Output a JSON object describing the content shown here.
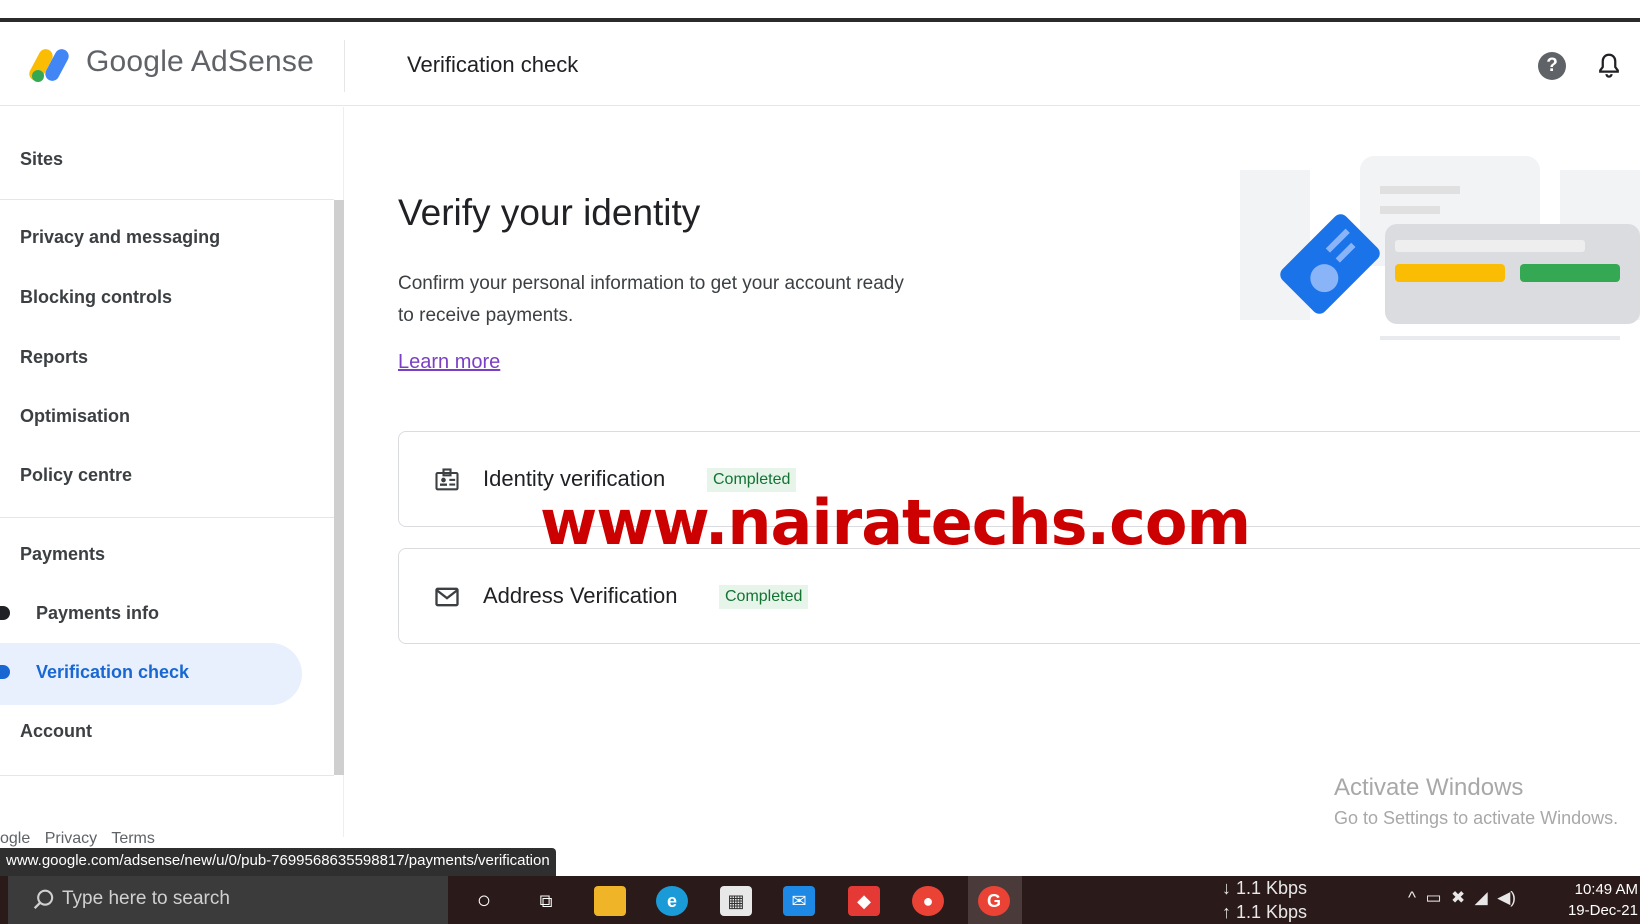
{
  "app": {
    "brand": "Google AdSense",
    "page_heading": "Verification check"
  },
  "sidebar": {
    "items": [
      {
        "label": "Sites"
      },
      {
        "label": "Privacy and messaging"
      },
      {
        "label": "Blocking controls"
      },
      {
        "label": "Reports"
      },
      {
        "label": "Optimisation"
      },
      {
        "label": "Policy centre"
      },
      {
        "label": "Payments"
      },
      {
        "label": "Payments info"
      },
      {
        "label": "Verification check",
        "active": true
      },
      {
        "label": "Account"
      }
    ],
    "footer": [
      "ogle",
      "Privacy",
      "Terms"
    ]
  },
  "main": {
    "title": "Verify your identity",
    "description": "Confirm your personal information to get your account ready to receive payments.",
    "learn_more": "Learn more",
    "cards": [
      {
        "label": "Identity verification",
        "status": "Completed",
        "icon": "id-badge-icon"
      },
      {
        "label": "Address Verification",
        "status": "Completed",
        "icon": "mail-icon"
      }
    ]
  },
  "watermark": "www.nairatechs.com",
  "activate_windows": {
    "title": "Activate Windows",
    "subtitle": "Go to Settings to activate Windows."
  },
  "status_url": "www.google.com/adsense/new/u/0/pub-7699568635598817/payments/verification",
  "taskbar": {
    "search_placeholder": "Type here to search",
    "net_down": "↓ 1.1 Kbps",
    "net_up": "↑ 1.1 Kbps",
    "time": "10:49 AM",
    "date": "19-Dec-21"
  },
  "colors": {
    "accent": "#1967d2",
    "badge_bg": "#e6f4ea",
    "badge_text": "#137333",
    "watermark": "#cc0000"
  }
}
